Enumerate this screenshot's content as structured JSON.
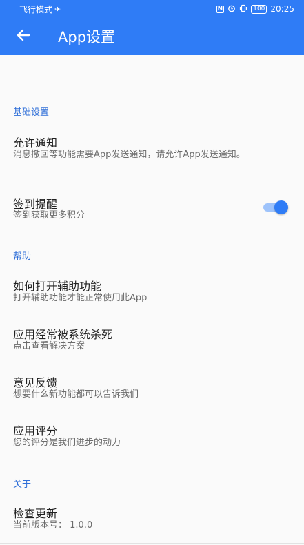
{
  "status_bar": {
    "left_text": "飞行模式",
    "airplane_icon": "✈",
    "nfc_icon": "N",
    "alarm_icon": "⏰",
    "vibrate_icon": "📳",
    "battery": "100",
    "time": "20:25"
  },
  "app_bar": {
    "title": "App设置",
    "back_icon": "arrow-left-icon",
    "color": "#2f7cf6"
  },
  "sections": {
    "basic": {
      "header": "基础设置",
      "notify": {
        "title": "允许通知",
        "subtitle": "消息撤回等功能需要App发送通知，请允许App发送通知。"
      },
      "checkin": {
        "title": "签到提醒",
        "subtitle": "签到获取更多积分",
        "enabled": true
      }
    },
    "help": {
      "header": "帮助",
      "accessibility": {
        "title": "如何打开辅助功能",
        "subtitle": "打开辅助功能才能正常使用此App"
      },
      "killed": {
        "title": "应用经常被系统杀死",
        "subtitle": "点击查看解决方案"
      },
      "feedback": {
        "title": "意见反馈",
        "subtitle": "想要什么新功能都可以告诉我们"
      },
      "rate": {
        "title": "应用评分",
        "subtitle": "您的评分是我们进步的动力"
      }
    },
    "about": {
      "header": "关于",
      "update": {
        "title": "检查更新",
        "subtitle": "当前版本号：  1.0.0"
      }
    }
  }
}
